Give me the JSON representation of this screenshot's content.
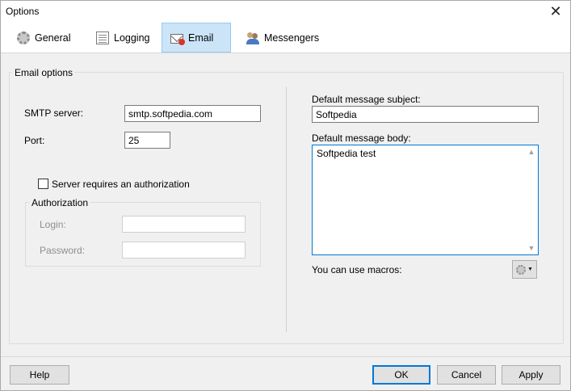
{
  "window": {
    "title": "Options"
  },
  "tabs": [
    {
      "label": "General",
      "icon": "gear-icon"
    },
    {
      "label": "Logging",
      "icon": "log-icon"
    },
    {
      "label": "Email",
      "icon": "email-icon",
      "active": true
    },
    {
      "label": "Messengers",
      "icon": "users-icon"
    }
  ],
  "email_options": {
    "group_label": "Email options",
    "smtp_label": "SMTP server:",
    "smtp_value": "smtp.softpedia.com",
    "port_label": "Port:",
    "port_value": "25",
    "auth_checkbox_label": "Server requires an authorization",
    "auth_checked": false,
    "auth_group_label": "Authorization",
    "login_label": "Login:",
    "login_value": "",
    "password_label": "Password:",
    "password_value": "",
    "subject_label": "Default message subject:",
    "subject_value": "Softpedia",
    "body_label": "Default message body:",
    "body_value": "Softpedia test",
    "macros_label": "You can use macros:"
  },
  "footer": {
    "help_label": "Help",
    "ok_label": "OK",
    "cancel_label": "Cancel",
    "apply_label": "Apply"
  },
  "colors": {
    "active_tab_bg": "#cce4f7",
    "active_tab_border": "#99c9ef",
    "focus_border": "#0078d7"
  }
}
